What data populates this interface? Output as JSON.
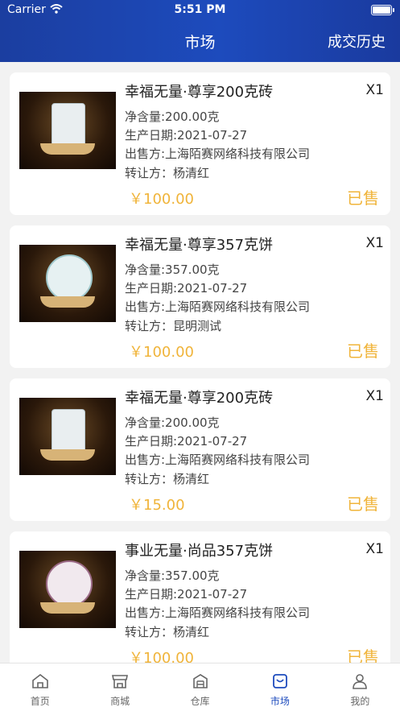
{
  "status_bar": {
    "carrier": "Carrier",
    "time": "5:51 PM"
  },
  "header": {
    "title": "市场",
    "history_label": "成交历史"
  },
  "colors": {
    "header_blue": "#1d4bbd",
    "price_gold": "#f0b43a",
    "active_tab": "#1d4bbd"
  },
  "items": [
    {
      "name": "幸福无量·尊享200克砖",
      "qty": "X1",
      "weight": "净含量:200.00克",
      "date": "生产日期:2021-07-27",
      "seller": "出售方:上海陌赛网络科技有限公司",
      "transferor": "转让方：杨清红",
      "price": "￥100.00",
      "status": "已售",
      "image_icon": "tea-brick-image"
    },
    {
      "name": "幸福无量·尊享357克饼",
      "qty": "X1",
      "weight": "净含量:357.00克",
      "date": "生产日期:2021-07-27",
      "seller": "出售方:上海陌赛网络科技有限公司",
      "transferor": "转让方：昆明测试",
      "price": "￥100.00",
      "status": "已售",
      "image_icon": "tea-cake-image"
    },
    {
      "name": "幸福无量·尊享200克砖",
      "qty": "X1",
      "weight": "净含量:200.00克",
      "date": "生产日期:2021-07-27",
      "seller": "出售方:上海陌赛网络科技有限公司",
      "transferor": "转让方：杨清红",
      "price": "￥15.00",
      "status": "已售",
      "image_icon": "tea-brick-image"
    },
    {
      "name": "事业无量·尚品357克饼",
      "qty": "X1",
      "weight": "净含量:357.00克",
      "date": "生产日期:2021-07-27",
      "seller": "出售方:上海陌赛网络科技有限公司",
      "transferor": "转让方：杨清红",
      "price": "￥100.00",
      "status": "已售",
      "image_icon": "tea-cake-image"
    }
  ],
  "tabs": [
    {
      "label": "首页",
      "icon": "home-icon"
    },
    {
      "label": "商城",
      "icon": "shop-icon"
    },
    {
      "label": "仓库",
      "icon": "warehouse-icon"
    },
    {
      "label": "市场",
      "icon": "market-icon",
      "active": true
    },
    {
      "label": "我的",
      "icon": "user-icon"
    }
  ]
}
